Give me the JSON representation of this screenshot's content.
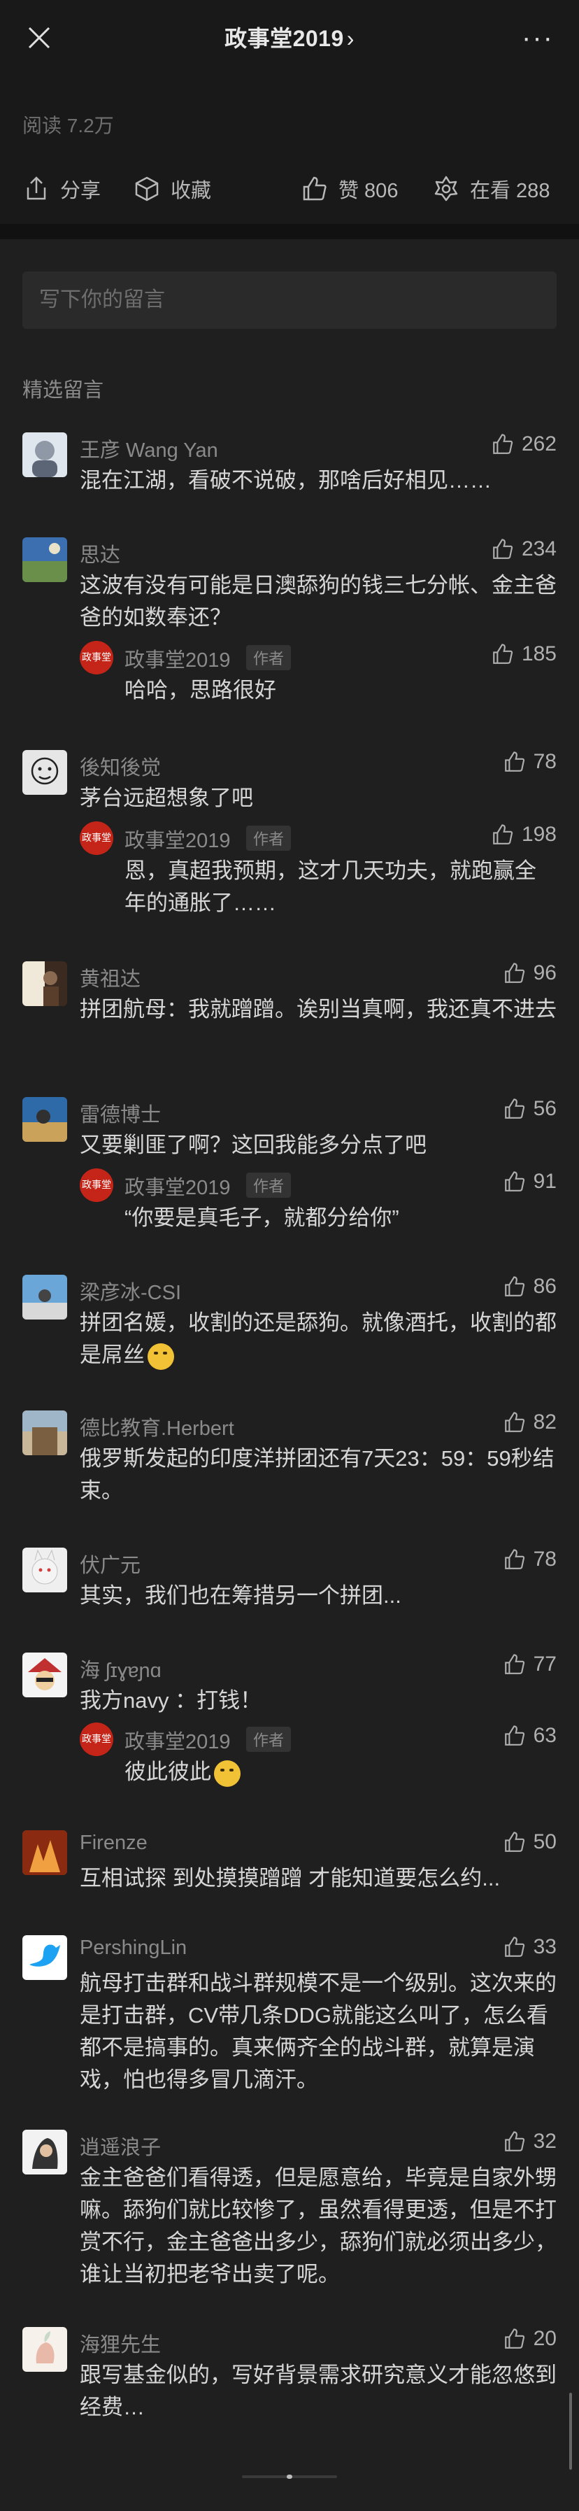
{
  "header": {
    "title": "政事堂2019",
    "chevron": "›",
    "more": "···"
  },
  "article": {
    "reads": "阅读 7.2万",
    "share_label": "分享",
    "collect_label": "收藏",
    "like_label": "赞 806",
    "watch_label": "在看 288"
  },
  "comment_input": {
    "placeholder": "写下你的留言"
  },
  "section_title": "精选留言",
  "author_tag": "作者",
  "author_avatar_text": "政事堂",
  "comments": [
    {
      "name": "王彦 Wang Yan",
      "likes": "262",
      "text": "混在江湖，看破不说破，那啥后好相见……"
    },
    {
      "name": "思达",
      "likes": "234",
      "text": "这波有没有可能是日澳舔狗的钱三七分帐、金主爸爸的如数奉还？",
      "reply": {
        "name": "政事堂2019",
        "likes": "185",
        "text": "哈哈，思路很好"
      }
    },
    {
      "name": "後知後觉",
      "likes": "78",
      "text": "茅台远超想象了吧",
      "reply": {
        "name": "政事堂2019",
        "likes": "198",
        "text": "恩，真超我预期，这才几天功夫，就跑赢全年的通胀了……"
      }
    },
    {
      "name": "黄祖达",
      "likes": "96",
      "text": "拼团航母：我就蹭蹭。诶别当真啊，我还真不进去"
    },
    {
      "name": "雷德博士",
      "likes": "56",
      "text": "又要剿匪了啊？这回我能多分点了吧",
      "reply": {
        "name": "政事堂2019",
        "likes": "91",
        "text": "“你要是真毛子，就都分给你”"
      }
    },
    {
      "name": "梁彦冰-CSI",
      "likes": "86",
      "text": "拼团名媛，收割的还是舔狗。就像酒托，收割的都是屌丝"
    },
    {
      "name": "德比教育.Herbert",
      "likes": "82",
      "text": "俄罗斯发起的印度洋拼团还有7天23：59：59秒结束。"
    },
    {
      "name": "伏广元",
      "likes": "78",
      "text": "其实，我们也在筹措另一个拼团..."
    },
    {
      "name": "海 ʃɪɣɐɲɑ",
      "likes": "77",
      "text": "我方navy ：打钱！",
      "reply": {
        "name": "政事堂2019",
        "likes": "63",
        "text": "彼此彼此"
      }
    },
    {
      "name": "Firenze",
      "likes": "50",
      "text": "互相试探 到处摸摸蹭蹭 才能知道要怎么约..."
    },
    {
      "name": "PershingLin",
      "likes": "33",
      "text": "航母打击群和战斗群规模不是一个级别。这次来的是打击群，CV带几条DDG就能这么叫了，怎么看都不是搞事的。真来俩齐全的战斗群，就算是演戏，怕也得多冒几滴汗。"
    },
    {
      "name": "逍遥浪子",
      "likes": "32",
      "text": "金主爸爸们看得透，但是愿意给，毕竟是自家外甥嘛。舔狗们就比较惨了，虽然看得更透，但是不打赏不行，金主爸爸出多少，舔狗们就必须出多少，谁让当初把老爷出卖了呢。"
    },
    {
      "name": "海狸先生",
      "likes": "20",
      "text": "跟写基金似的，写好背景需求研究意义才能忽悠到经费…"
    }
  ]
}
